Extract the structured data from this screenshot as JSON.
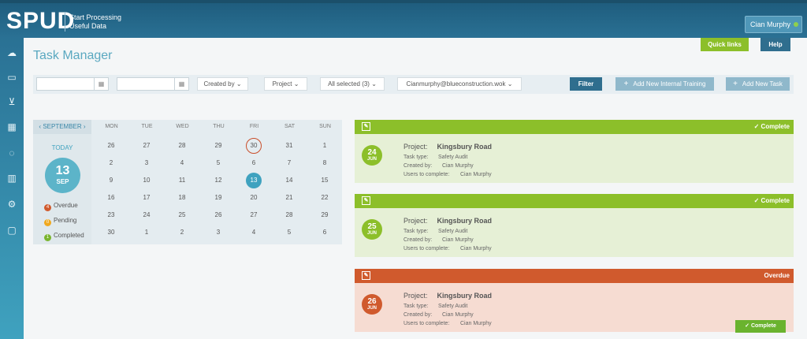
{
  "app": {
    "logo": "SPUD",
    "tagline_line1": "Start Processing",
    "tagline_line2": "Useful Data"
  },
  "header": {
    "user": "Cian Murphy",
    "quick_links": "Quick links",
    "help": "Help",
    "title": "Task Manager"
  },
  "sidebar": {
    "items": [
      "cloud-icon",
      "folder-icon",
      "cart-icon",
      "calculator-icon",
      "chat-icon",
      "chart-icon",
      "gear-icon",
      "card-icon"
    ]
  },
  "filters": {
    "date_from": "",
    "date_to": "",
    "created_by": "Created by",
    "project": "Project",
    "selected": "All selected (3)",
    "email": "Cianmurphy@blueconstruction.wok",
    "filter": "Filter",
    "add_training": "Add New Internal Training",
    "add_task": "Add New Task"
  },
  "calendar": {
    "month": "SEPTEMBER",
    "today_label": "TODAY",
    "today_day": "13",
    "today_month": "SEP",
    "weekdays": [
      "MON",
      "TUE",
      "WED",
      "THU",
      "FRI",
      "SAT",
      "SUN"
    ],
    "weeks": [
      [
        "26",
        "27",
        "28",
        "29",
        "30",
        "31",
        "1"
      ],
      [
        "2",
        "3",
        "4",
        "5",
        "6",
        "7",
        "8"
      ],
      [
        "9",
        "10",
        "11",
        "12",
        "13",
        "14",
        "15"
      ],
      [
        "16",
        "17",
        "18",
        "19",
        "20",
        "21",
        "22"
      ],
      [
        "23",
        "24",
        "25",
        "26",
        "27",
        "28",
        "29"
      ],
      [
        "30",
        "1",
        "2",
        "3",
        "4",
        "5",
        "6"
      ]
    ],
    "legend": [
      {
        "count": "4",
        "label": "Overdue",
        "color": "#d05a2d"
      },
      {
        "count": "0",
        "label": "Pending",
        "color": "#f0a81e"
      },
      {
        "count": "1",
        "label": "Completed",
        "color": "#7ab52e"
      }
    ]
  },
  "tasks": [
    {
      "status": "Complete",
      "day": "24",
      "month": "JUN",
      "project_label": "Project:",
      "project": "Kingsbury Road",
      "task_type_label": "Task type:",
      "task_type": "Safety Audit",
      "created_by_label": "Created by:",
      "created_by": "Cian Murphy",
      "users_label": "Users to complete:",
      "users": "Cian Murphy",
      "head_color": "#8cbf2a",
      "body_color": "#e6f0d6"
    },
    {
      "status": "Complete",
      "day": "25",
      "month": "JUN",
      "project_label": "Project:",
      "project": "Kingsbury Road",
      "task_type_label": "Task type:",
      "task_type": "Safety Audit",
      "created_by_label": "Created by:",
      "created_by": "Cian Murphy",
      "users_label": "Users to complete:",
      "users": "Cian Murphy",
      "head_color": "#8cbf2a",
      "body_color": "#e6f0d6"
    },
    {
      "status": "Overdue",
      "day": "26",
      "month": "JUN",
      "project_label": "Project:",
      "project": "Kingsbury Road",
      "task_type_label": "Task type:",
      "task_type": "Safety Audit",
      "created_by_label": "Created by:",
      "created_by": "Cian Murphy",
      "users_label": "Users to complete:",
      "users": "Cian Murphy",
      "head_color": "#d05a2d",
      "body_color": "#f6dcd2",
      "action": "Complete"
    }
  ]
}
